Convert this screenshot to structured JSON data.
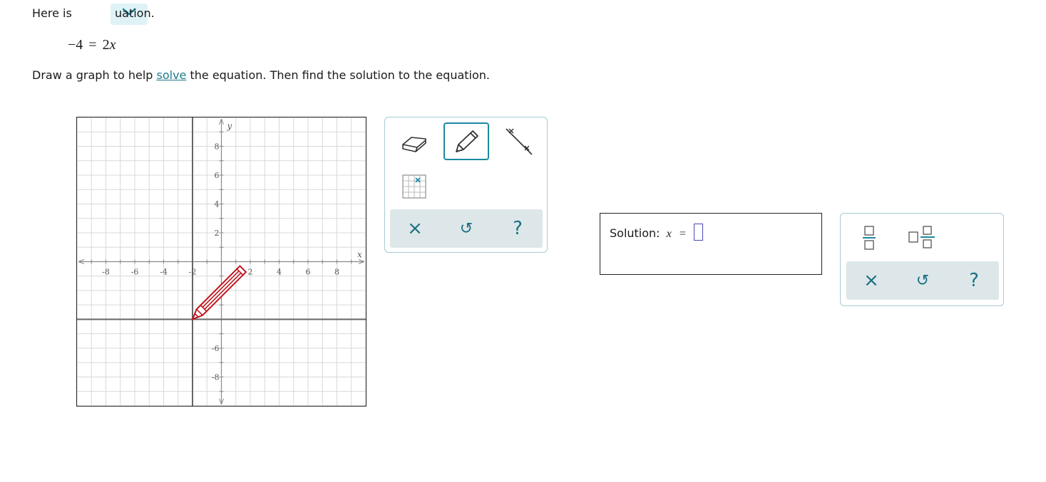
{
  "intro": {
    "before": "Here is",
    "after": "uation."
  },
  "equation": {
    "lhs": "−4",
    "eq": "=",
    "rhs_coef": "2",
    "rhs_var": "x"
  },
  "instruction": {
    "before": "Draw a graph to help ",
    "link": "solve",
    "after": " the equation. Then find the solution to the equation."
  },
  "graph": {
    "x_axis_label": "x",
    "y_axis_label": "y",
    "x_tick_labels": [
      "-8",
      "-6",
      "-4",
      "-2",
      "2",
      "4",
      "6",
      "8"
    ],
    "y_tick_labels": [
      "8",
      "6",
      "4",
      "2",
      "-6",
      "-8"
    ],
    "x_range": [
      -10,
      10
    ],
    "y_range": [
      -10,
      10
    ],
    "horizontal_line_y": -4,
    "vertical_line_x": -2,
    "cursor": "pencil-icon"
  },
  "tools": {
    "items": [
      "eraser-icon",
      "pencil-icon",
      "line-icon",
      "point-grid-icon"
    ],
    "selected": "pencil-icon",
    "bar": {
      "clear": "×",
      "undo": "↺",
      "help": "?"
    }
  },
  "answer": {
    "label": "Solution:",
    "var": "x",
    "eq": "="
  },
  "keypad": {
    "items": [
      "fraction-icon",
      "mixed-number-icon"
    ],
    "bar": {
      "clear": "×",
      "undo": "↺",
      "help": "?"
    }
  },
  "colors": {
    "accent": "#1b8aa0",
    "pencil": "#c0151b",
    "grid": "#d8d8d8",
    "axis": "#888888"
  }
}
